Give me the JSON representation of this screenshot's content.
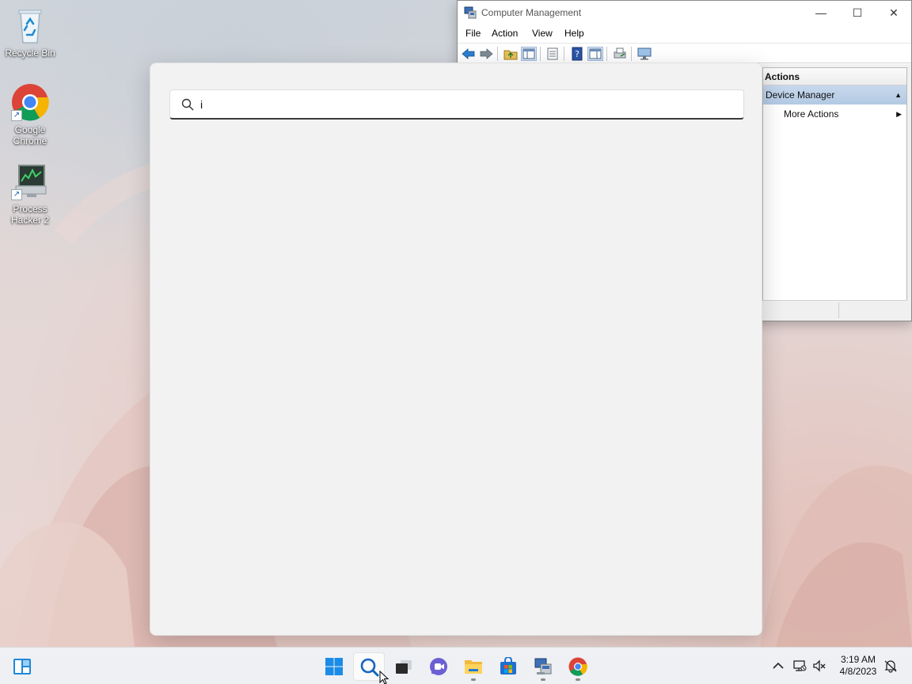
{
  "desktop": {
    "icons": [
      {
        "label": "Recycle Bin",
        "icon": "recycle-bin-icon"
      },
      {
        "label": "Google Chrome",
        "icon": "chrome-icon"
      },
      {
        "label": "Process Hacker 2",
        "icon": "process-hacker-icon"
      }
    ]
  },
  "computer_management": {
    "title": "Computer Management",
    "menu": [
      "File",
      "Action",
      "View",
      "Help"
    ],
    "window_buttons": {
      "minimize": "—",
      "maximize": "☐",
      "close": "✕"
    },
    "actions_pane": {
      "header": "Actions",
      "group": "Device Manager",
      "items": [
        "More Actions"
      ]
    }
  },
  "search": {
    "query": "i"
  },
  "taskbar": {
    "apps": [
      "widgets",
      "start",
      "search",
      "task-view",
      "chat",
      "file-explorer",
      "microsoft-store",
      "computer-management",
      "chrome"
    ],
    "clock": {
      "time": "3:19 AM",
      "date": "4/8/2023"
    }
  },
  "colors": {
    "accent": "#0067c0",
    "flyout_bg": "#f2f2f2",
    "actions_group_bg": "#b9cde6"
  }
}
